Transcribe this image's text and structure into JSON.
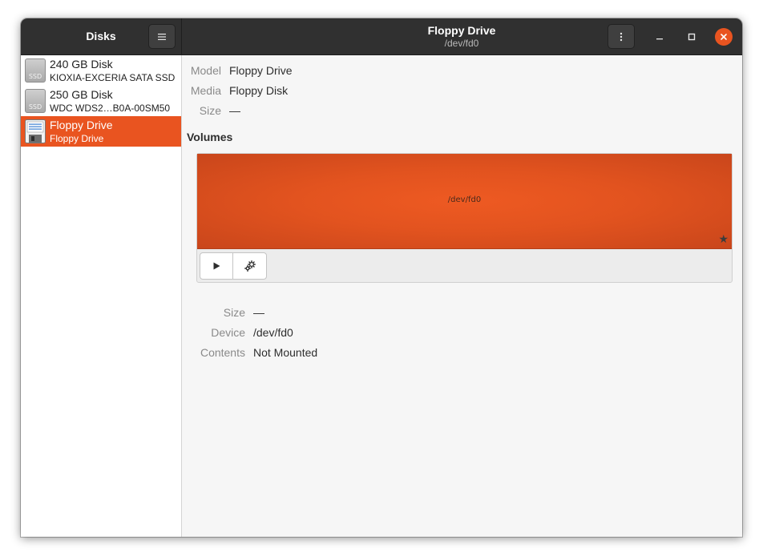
{
  "app": {
    "sidebar_title": "Disks",
    "window_title": "Floppy Drive",
    "window_subtitle": "/dev/fd0"
  },
  "icons": {
    "hamburger": "hamburger-menu-icon",
    "kebab": "kebab-menu-icon",
    "minimize": "minimize-icon",
    "maximize": "maximize-icon",
    "close": "close-icon",
    "play": "play-icon",
    "gears": "gears-icon",
    "star": "star-icon"
  },
  "colors": {
    "accent": "#e95420",
    "header": "#303030"
  },
  "sidebar": {
    "items": [
      {
        "name": "240 GB Disk",
        "sub": "KIOXIA-EXCERIA SATA SSD",
        "icon_text": "SSD",
        "icon": "ssd-drive-icon",
        "selected": false
      },
      {
        "name": "250 GB Disk",
        "sub": "WDC  WDS2…B0A-00SM50",
        "icon_text": "SSD",
        "icon": "ssd-drive-icon",
        "selected": false
      },
      {
        "name": "Floppy Drive",
        "sub": "Floppy Drive",
        "icon": "floppy-drive-icon",
        "selected": true
      }
    ]
  },
  "drive_info": {
    "model_label": "Model",
    "model_value": "Floppy Drive",
    "media_label": "Media",
    "media_value": "Floppy Disk",
    "size_label": "Size",
    "size_value": "—"
  },
  "volumes": {
    "title": "Volumes",
    "partition_label": "/dev/fd0"
  },
  "volume_info": {
    "size_label": "Size",
    "size_value": "—",
    "device_label": "Device",
    "device_value": "/dev/fd0",
    "contents_label": "Contents",
    "contents_value": "Not Mounted"
  }
}
